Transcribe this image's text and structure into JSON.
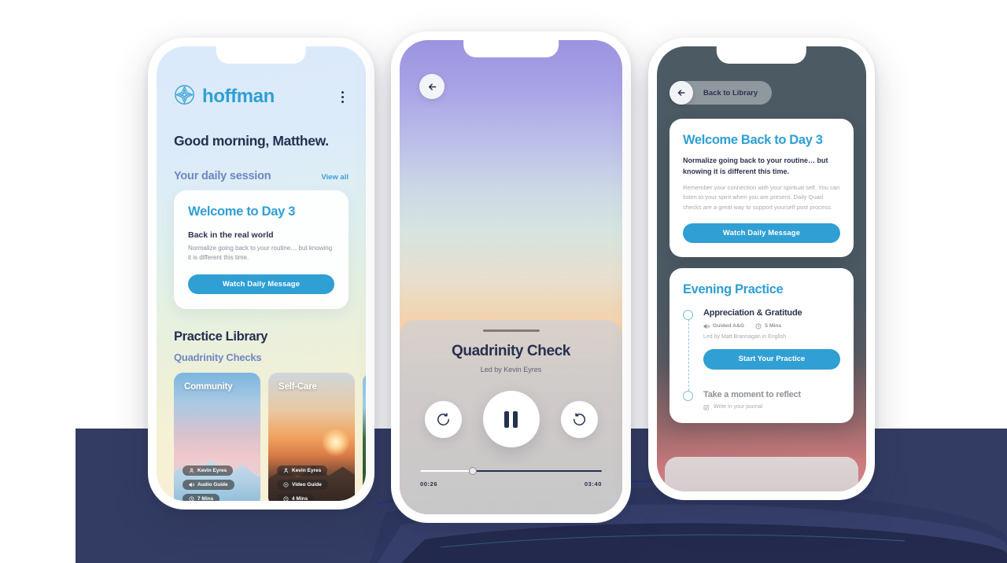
{
  "theme": {
    "accent": "#2f9fd4",
    "navy": "#26304f",
    "periwinkle": "#6f86c4",
    "slate": "#4c5a64",
    "bg_panel": "#333c63"
  },
  "phone1": {
    "brand": "hoffman",
    "logo_icon": "compass-star-icon",
    "menu_icon": "kebab-menu-icon",
    "greeting": "Good morning, Matthew.",
    "section_title": "Your daily session",
    "view_all": "View all",
    "daily_card": {
      "title": "Welcome to Day 3",
      "subtitle": "Back in the real world",
      "body": "Normalize going back to your routine… but knowing it is different this time.",
      "cta": "Watch Daily Message"
    },
    "library_title": "Practice Library",
    "library_subtitle": "Quadrinity Checks",
    "cards": [
      {
        "caption": "Community",
        "image": "snowy-mountain",
        "chips": [
          {
            "icon": "person-icon",
            "label": "Kevin Eyres"
          },
          {
            "icon": "audio-icon",
            "label": "Audio Guide"
          },
          {
            "icon": "clock-icon",
            "label": "7 Mins"
          }
        ]
      },
      {
        "caption": "Self-Care",
        "image": "sunset-mountains",
        "chips": [
          {
            "icon": "person-icon",
            "label": "Kevin Eyres"
          },
          {
            "icon": "play-icon",
            "label": "Video Guide"
          },
          {
            "icon": "clock-icon",
            "label": "4 Mins"
          }
        ]
      },
      {
        "caption": "",
        "image": "forest",
        "chips": []
      }
    ]
  },
  "phone2": {
    "back_icon": "arrow-left-icon",
    "background_image": "sunset-sky",
    "player": {
      "title": "Quadrinity Check",
      "subtitle": "Led by Kevin Eyres",
      "rewind_icon": "rewind-15-icon",
      "play_state_icon": "pause-icon",
      "forward_icon": "forward-15-icon",
      "elapsed": "00:26",
      "duration": "03:40",
      "progress_percent": 29
    }
  },
  "phone3": {
    "back_icon": "arrow-left-icon",
    "back_label": "Back to Library",
    "welcome_card": {
      "title": "Welcome Back to Day 3",
      "lead": "Normalize going back to your routine… but knowing it is different this time.",
      "body": "Remember your connection with your spiritual self. You can listen to your spirit when you are present. Daily Quad checks are a great way to support yourself post process.",
      "cta": "Watch Daily Message"
    },
    "evening_card": {
      "title": "Evening Practice",
      "step1": {
        "title": "Appreciation & Gratitude",
        "meta": [
          {
            "icon": "audio-icon",
            "label": "Guided A&G"
          },
          {
            "icon": "clock-icon",
            "label": "5 Mins"
          }
        ],
        "led_by": "Led by Matt Brannagan in English",
        "cta": "Start Your Practice"
      },
      "step2": {
        "title": "Take a moment to reflect",
        "journal_icon": "pencil-square-icon",
        "journal_label": "Write in your journal"
      }
    }
  }
}
